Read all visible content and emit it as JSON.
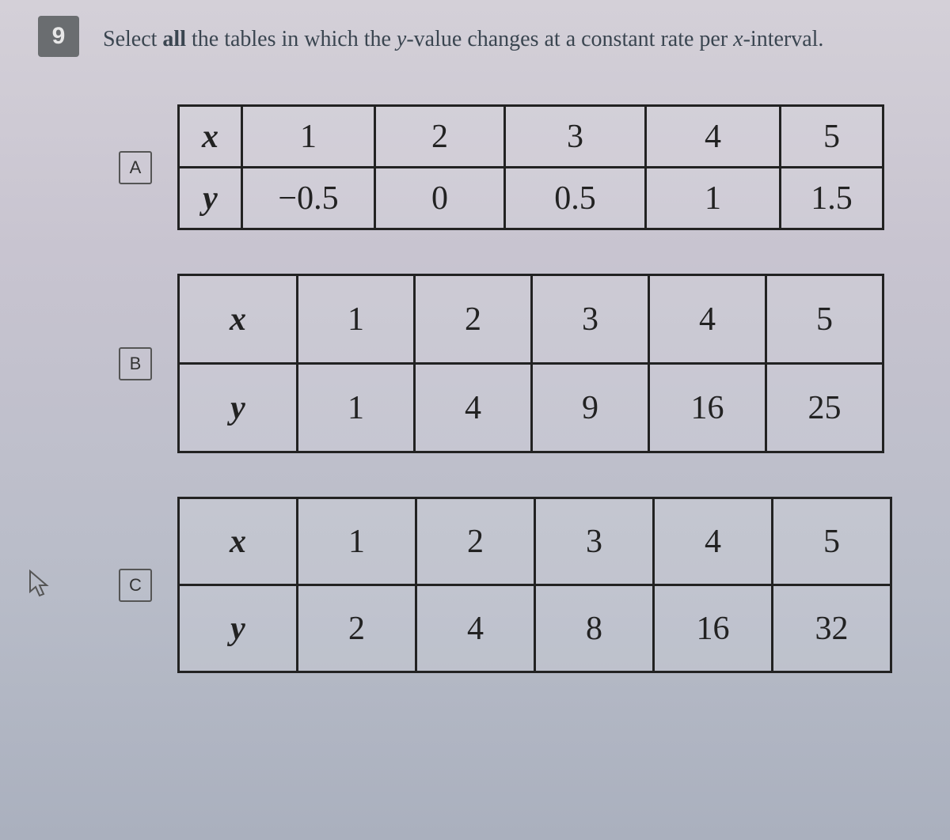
{
  "question": {
    "number": "9",
    "prompt_pre": "Select ",
    "prompt_bold": "all",
    "prompt_mid": " the tables in which the ",
    "var_y": "y",
    "prompt_mid2": "-value changes at a constant rate per ",
    "var_x": "x",
    "prompt_end": "-interval."
  },
  "tables": [
    {
      "id": "A",
      "label": "A",
      "row_x_label": "x",
      "row_y_label": "y",
      "x": [
        "1",
        "2",
        "3",
        "4",
        "5"
      ],
      "y": [
        "−0.5",
        "0",
        "0.5",
        "1",
        "1.5"
      ]
    },
    {
      "id": "B",
      "label": "B",
      "row_x_label": "x",
      "row_y_label": "y",
      "x": [
        "1",
        "2",
        "3",
        "4",
        "5"
      ],
      "y": [
        "1",
        "4",
        "9",
        "16",
        "25"
      ]
    },
    {
      "id": "C",
      "label": "C",
      "row_x_label": "x",
      "row_y_label": "y",
      "x": [
        "1",
        "2",
        "3",
        "4",
        "5"
      ],
      "y": [
        "2",
        "4",
        "8",
        "16",
        "32"
      ]
    }
  ],
  "cursor_glyph": "↖"
}
